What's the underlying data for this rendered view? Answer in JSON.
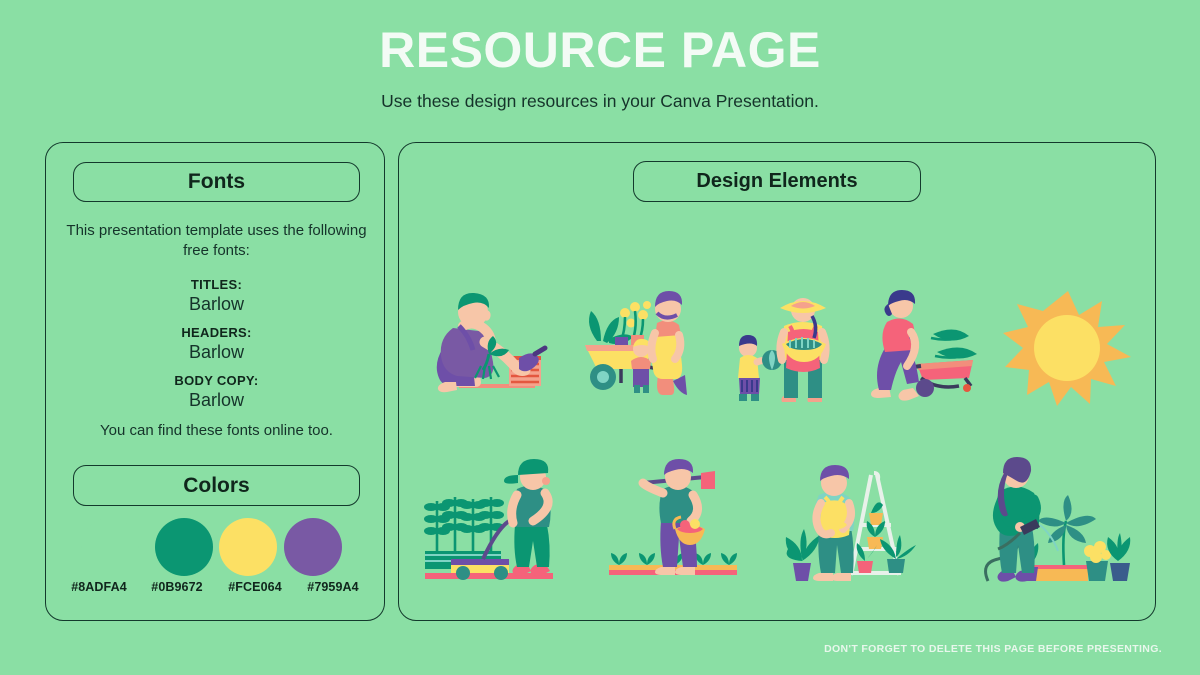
{
  "header": {
    "title": "RESOURCE PAGE",
    "subtitle": "Use these design resources in your Canva Presentation."
  },
  "fonts_panel": {
    "heading": "Fonts",
    "intro": "This presentation template uses the following free fonts:",
    "groups": [
      {
        "role": "TITLES:",
        "font": "Barlow"
      },
      {
        "role": "HEADERS:",
        "font": "Barlow"
      },
      {
        "role": "BODY COPY:",
        "font": "Barlow"
      }
    ],
    "outro": "You can find these fonts online too."
  },
  "colors_panel": {
    "heading": "Colors",
    "swatches": [
      {
        "hex": "#8ADFA4",
        "label": "#8ADFA4"
      },
      {
        "hex": "#0B9672",
        "label": "#0B9672"
      },
      {
        "hex": "#FCE064",
        "label": "#FCE064"
      },
      {
        "hex": "#7959A4",
        "label": "#7959A4"
      }
    ]
  },
  "elements_panel": {
    "heading": "Design Elements",
    "row1": [
      "kneeling-gardener-planting",
      "gardener-with-wheelbarrow-of-plants",
      "adult-with-harvest-basket-and-child",
      "person-pushing-pink-wheelbarrow",
      "sun"
    ],
    "row2": [
      "person-mowing-lawn",
      "farmer-with-hoe-and-basket",
      "person-with-plant-ladder-shelf",
      "person-watering-potted-plants"
    ]
  },
  "footer": {
    "note": "DON'T FORGET TO DELETE THIS PAGE BEFORE PRESENTING."
  },
  "theme": {
    "background": "#8ADFA4",
    "ink": "#13392c",
    "title_color": "#F3FBF5"
  }
}
